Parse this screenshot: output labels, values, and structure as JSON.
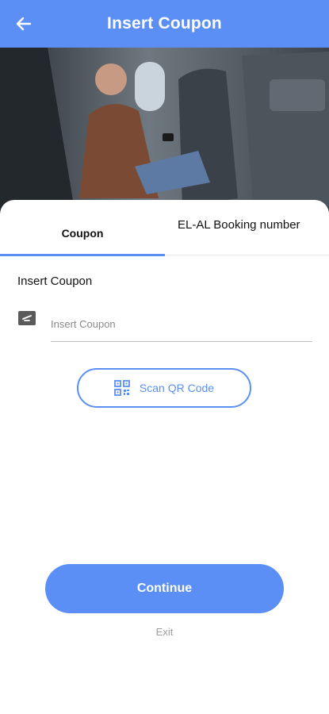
{
  "appbar": {
    "title": "Insert Coupon",
    "back_icon": "arrow-left-icon",
    "color": "#5b8ff5"
  },
  "hero": {
    "image": "passenger-using-phone-on-airplane"
  },
  "tabs": [
    {
      "label": "Coupon",
      "selected": true
    },
    {
      "label": "EL-AL Booking number",
      "selected": false
    }
  ],
  "form": {
    "section_label": "Insert Coupon",
    "field_icon": "ticket-icon",
    "coupon_placeholder": "Insert Coupon",
    "coupon_value": ""
  },
  "scan_button": {
    "label": "Scan QR Code",
    "icon": "qr-code-icon"
  },
  "actions": {
    "continue_label": "Continue",
    "exit_label": "Exit"
  }
}
